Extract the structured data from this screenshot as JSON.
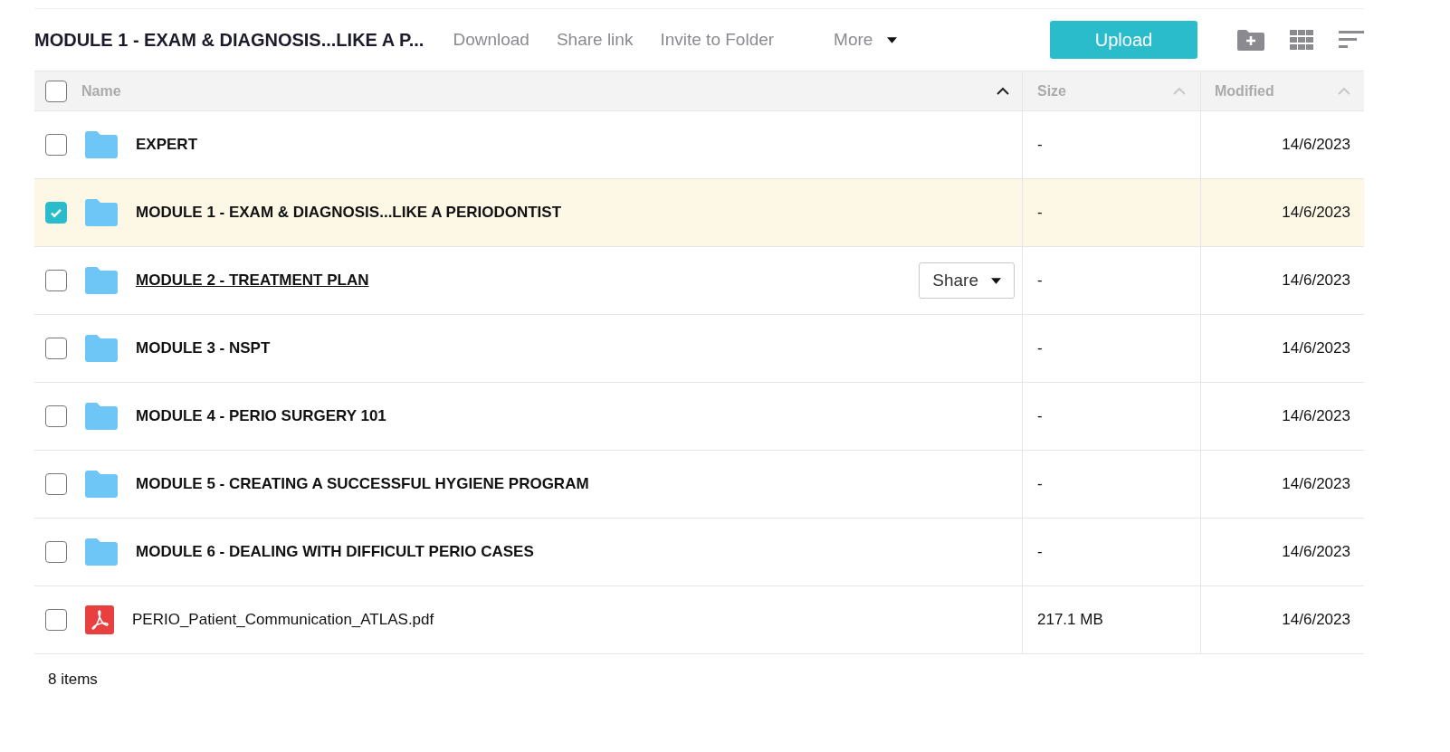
{
  "toolbar": {
    "folder_title": "MODULE 1 - EXAM & DIAGNOSIS...LIKE A P...",
    "actions": [
      "Download",
      "Share link",
      "Invite to Folder"
    ],
    "more": "More",
    "upload": "Upload"
  },
  "table": {
    "select_all": {
      "checked": false
    },
    "columns": [
      {
        "label": "Name",
        "sorted": true
      },
      {
        "label": "Size",
        "sorted": false
      },
      {
        "label": "Modified",
        "sorted": false
      }
    ],
    "rows": [
      {
        "kind": "folder",
        "name": "EXPERT",
        "size": "-",
        "modified": "14/6/2023",
        "selected": false,
        "hovered": false
      },
      {
        "kind": "folder",
        "name": "MODULE 1 - EXAM & DIAGNOSIS...LIKE A PERIODONTIST",
        "size": "-",
        "modified": "14/6/2023",
        "selected": true,
        "hovered": false
      },
      {
        "kind": "folder",
        "name": "MODULE 2 - TREATMENT PLAN",
        "size": "-",
        "modified": "14/6/2023",
        "selected": false,
        "hovered": true,
        "share_button": "Share"
      },
      {
        "kind": "folder",
        "name": "MODULE 3 - NSPT",
        "size": "-",
        "modified": "14/6/2023",
        "selected": false,
        "hovered": false
      },
      {
        "kind": "folder",
        "name": "MODULE 4 - PERIO SURGERY 101",
        "size": "-",
        "modified": "14/6/2023",
        "selected": false,
        "hovered": false
      },
      {
        "kind": "folder",
        "name": "MODULE 5 - CREATING A SUCCESSFUL HYGIENE PROGRAM",
        "size": "-",
        "modified": "14/6/2023",
        "selected": false,
        "hovered": false
      },
      {
        "kind": "folder",
        "name": "MODULE 6 - DEALING WITH DIFFICULT PERIO CASES",
        "size": "-",
        "modified": "14/6/2023",
        "selected": false,
        "hovered": false
      },
      {
        "kind": "pdf",
        "name": "PERIO_Patient_Communication_ATLAS.pdf",
        "size": "217.1 MB",
        "modified": "14/6/2023",
        "selected": false,
        "hovered": false
      }
    ]
  },
  "status_bar": {
    "count": "8 items"
  }
}
